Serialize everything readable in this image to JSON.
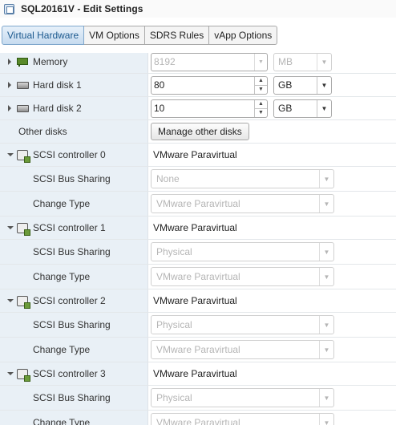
{
  "window": {
    "title": "SQL20161V - Edit Settings"
  },
  "tabs": [
    {
      "label": "Virtual Hardware",
      "active": true
    },
    {
      "label": "VM Options"
    },
    {
      "label": "SDRS Rules"
    },
    {
      "label": "vApp Options"
    }
  ],
  "memory": {
    "label": "Memory",
    "value": "8192",
    "unit": "MB",
    "icon": "memory-icon"
  },
  "hard_disk_1": {
    "label": "Hard disk 1",
    "value": "80",
    "unit": "GB",
    "icon": "hard-disk-icon"
  },
  "hard_disk_2": {
    "label": "Hard disk 2",
    "value": "10",
    "unit": "GB",
    "icon": "hard-disk-icon"
  },
  "other_disks": {
    "label": "Other disks",
    "button": "Manage other disks"
  },
  "scsi_controllers": [
    {
      "label": "SCSI controller 0",
      "type": "VMware Paravirtual",
      "bus_sharing_label": "SCSI Bus Sharing",
      "bus_sharing": "None",
      "change_type_label": "Change Type",
      "change_type": "VMware Paravirtual"
    },
    {
      "label": "SCSI controller 1",
      "type": "VMware Paravirtual",
      "bus_sharing_label": "SCSI Bus Sharing",
      "bus_sharing": "Physical",
      "change_type_label": "Change Type",
      "change_type": "VMware Paravirtual"
    },
    {
      "label": "SCSI controller 2",
      "type": "VMware Paravirtual",
      "bus_sharing_label": "SCSI Bus Sharing",
      "bus_sharing": "Physical",
      "change_type_label": "Change Type",
      "change_type": "VMware Paravirtual"
    },
    {
      "label": "SCSI controller 3",
      "type": "VMware Paravirtual",
      "bus_sharing_label": "SCSI Bus Sharing",
      "bus_sharing": "Physical",
      "change_type_label": "Change Type",
      "change_type": "VMware Paravirtual"
    }
  ],
  "colors": {
    "label_column": "#e9f0f6",
    "active_tab": "#c6dbef",
    "disabled_text": "#b5b5b5"
  }
}
